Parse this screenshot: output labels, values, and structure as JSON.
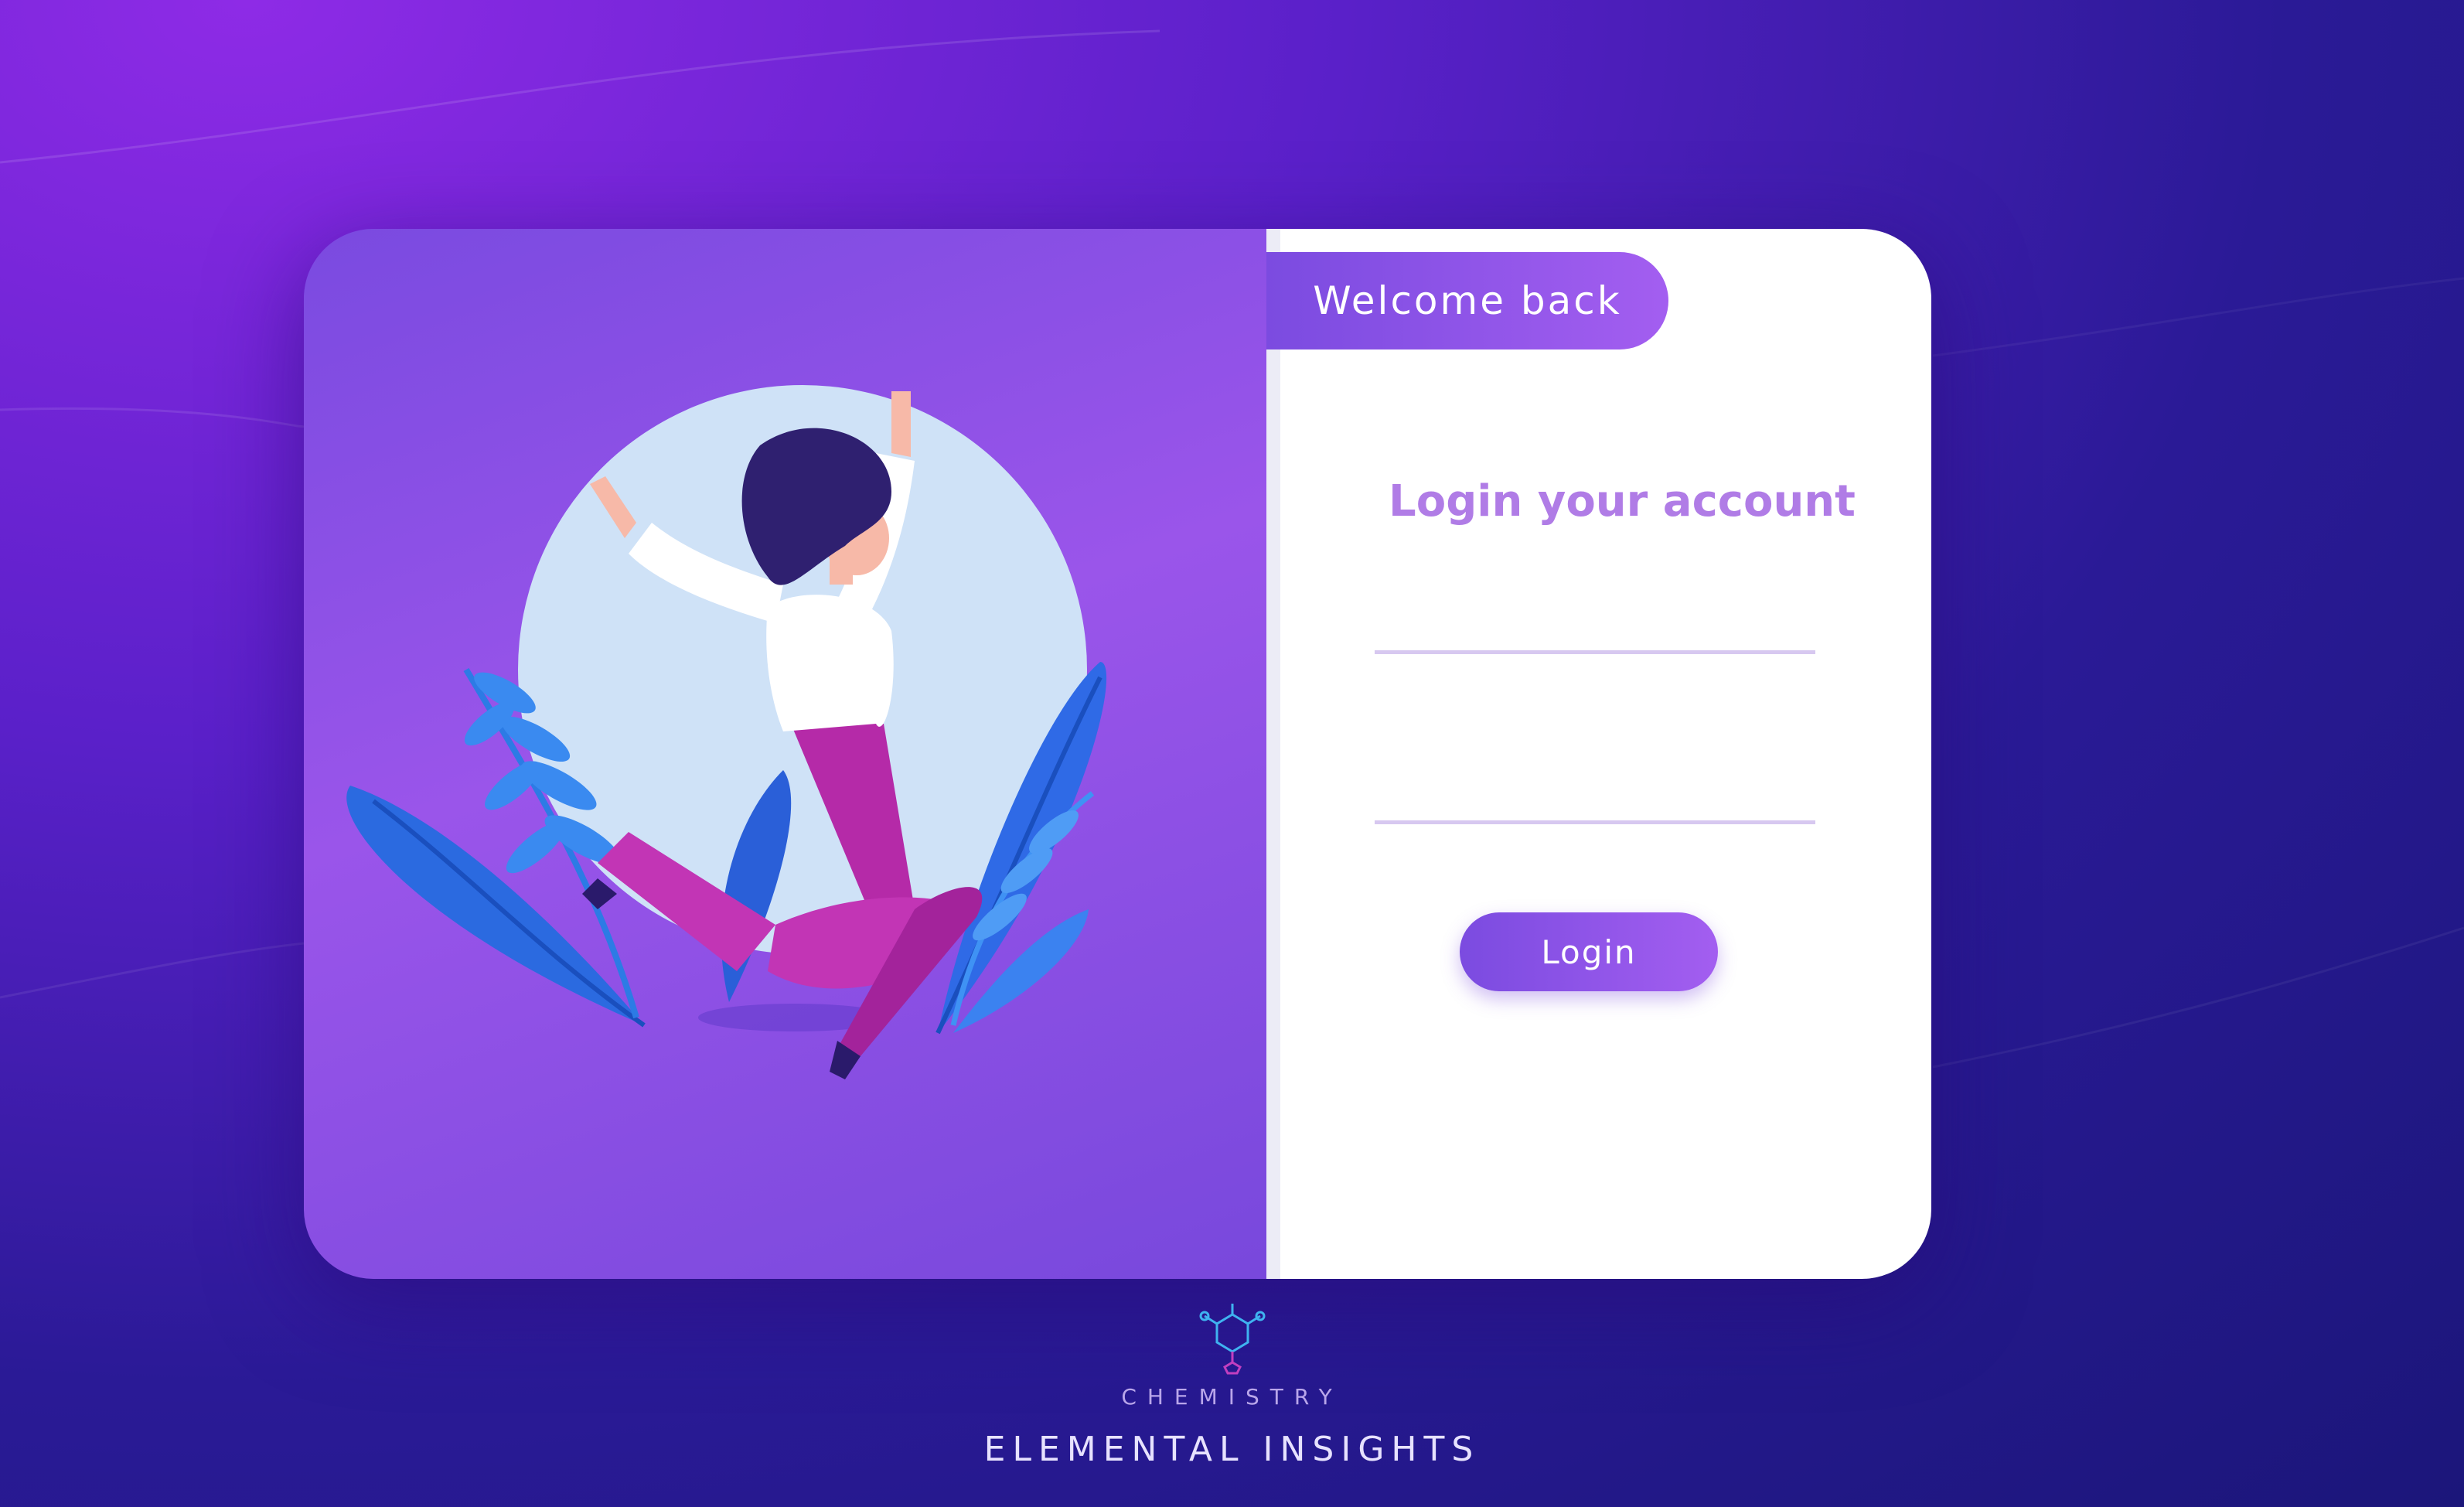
{
  "login": {
    "welcome_label": "Welcome back",
    "title": "Login your account",
    "username_value": "",
    "password_value": "",
    "button_label": "Login"
  },
  "brand": {
    "subtitle": "CHEMISTRY",
    "name": "ELEMENTAL INSIGHTS",
    "logo_icon": "molecule-icon"
  },
  "colors": {
    "accent": "#9a55ea",
    "title": "#b07ce6",
    "background_dark": "#1b167a"
  }
}
